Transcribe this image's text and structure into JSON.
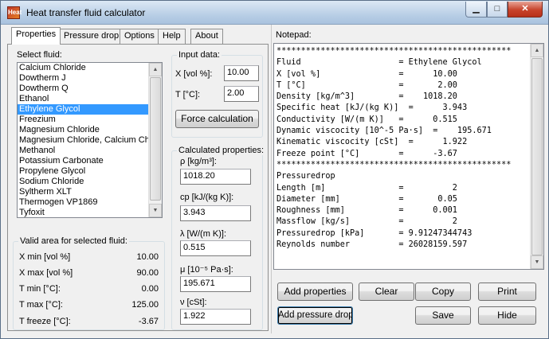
{
  "window": {
    "title": "Heat transfer fluid calculator",
    "icon_text": "Heat"
  },
  "tabs": [
    {
      "label": "Properties"
    },
    {
      "label": "Pressure drop"
    },
    {
      "label": "Options"
    },
    {
      "label": "Help"
    },
    {
      "label": "About"
    }
  ],
  "fluid": {
    "label": "Select fluid:",
    "items": [
      "Calcium Chloride",
      "Dowtherm J",
      "Dowtherm Q",
      "Ethanol",
      "Ethylene Glycol",
      "Freezium",
      "Magnesium Chloride",
      "Magnesium Chloride, Calcium Chloride",
      "Methanol",
      "Potassium Carbonate",
      "Propylene Glycol",
      "Sodium Chloride",
      "Syltherm XLT",
      "Thermogen VP1869",
      "Tyfoxit"
    ],
    "selected": "Ethylene Glycol"
  },
  "valid_area": {
    "legend": "Valid area for selected fluid:",
    "rows": [
      {
        "label": "X min [vol %]",
        "value": "10.00"
      },
      {
        "label": "X max [vol %]",
        "value": "90.00"
      },
      {
        "label": "T min [°C]:",
        "value": "0.00"
      },
      {
        "label": "T max [°C]:",
        "value": "125.00"
      },
      {
        "label": "T freeze [°C]:",
        "value": "-3.67"
      }
    ]
  },
  "input": {
    "legend": "Input data:",
    "x_label": "X [vol %]:",
    "x_value": "10.00",
    "t_label": "T [°C]:",
    "t_value": "2.00",
    "calc_button": "Force calculation"
  },
  "calculated": {
    "legend": "Calculated properties:",
    "rho_label": "ρ [kg/m³]:",
    "rho_value": "1018.20",
    "cp_label": "cp [kJ/(kg K)]:",
    "cp_value": "3.943",
    "lambda_label": "λ [W/(m K)]:",
    "lambda_value": "0.515",
    "mu_label": "μ [10⁻⁵ Pa·s]:",
    "mu_value": "195.671",
    "nu_label": "ν [cSt]:",
    "nu_value": "1.922"
  },
  "notepad": {
    "label": "Notepad:",
    "text": "************************************************\nFluid                    = Ethylene Glycol\nX [vol %]                =      10.00\nT [°C]                   =       2.00\nDensity [kg/m^3]         =    1018.20\nSpecific heat [kJ/(kg K)]  =      3.943\nConductivity [W/(m K)]   =      0.515\nDynamic viscocity [10^-5 Pa·s]  =    195.671\nKinematic viscocity [cSt]  =      1.922\nFreeze point [°C]        =      -3.67\n************************************************\nPressuredrop\nLength [m]               =          2\nDiameter [mm]            =       0.05\nRoughness [mm]           =      0.001\nMassflow [kg/s]          =          2\nPressuredrop [kPa]       = 9.91247344743\nReynolds number          = 26028159.597"
  },
  "buttons": {
    "add_properties": "Add properties",
    "clear": "Clear",
    "copy": "Copy",
    "print": "Print",
    "add_pressure_drop": "Add pressure drop",
    "save": "Save",
    "hide": "Hide"
  }
}
